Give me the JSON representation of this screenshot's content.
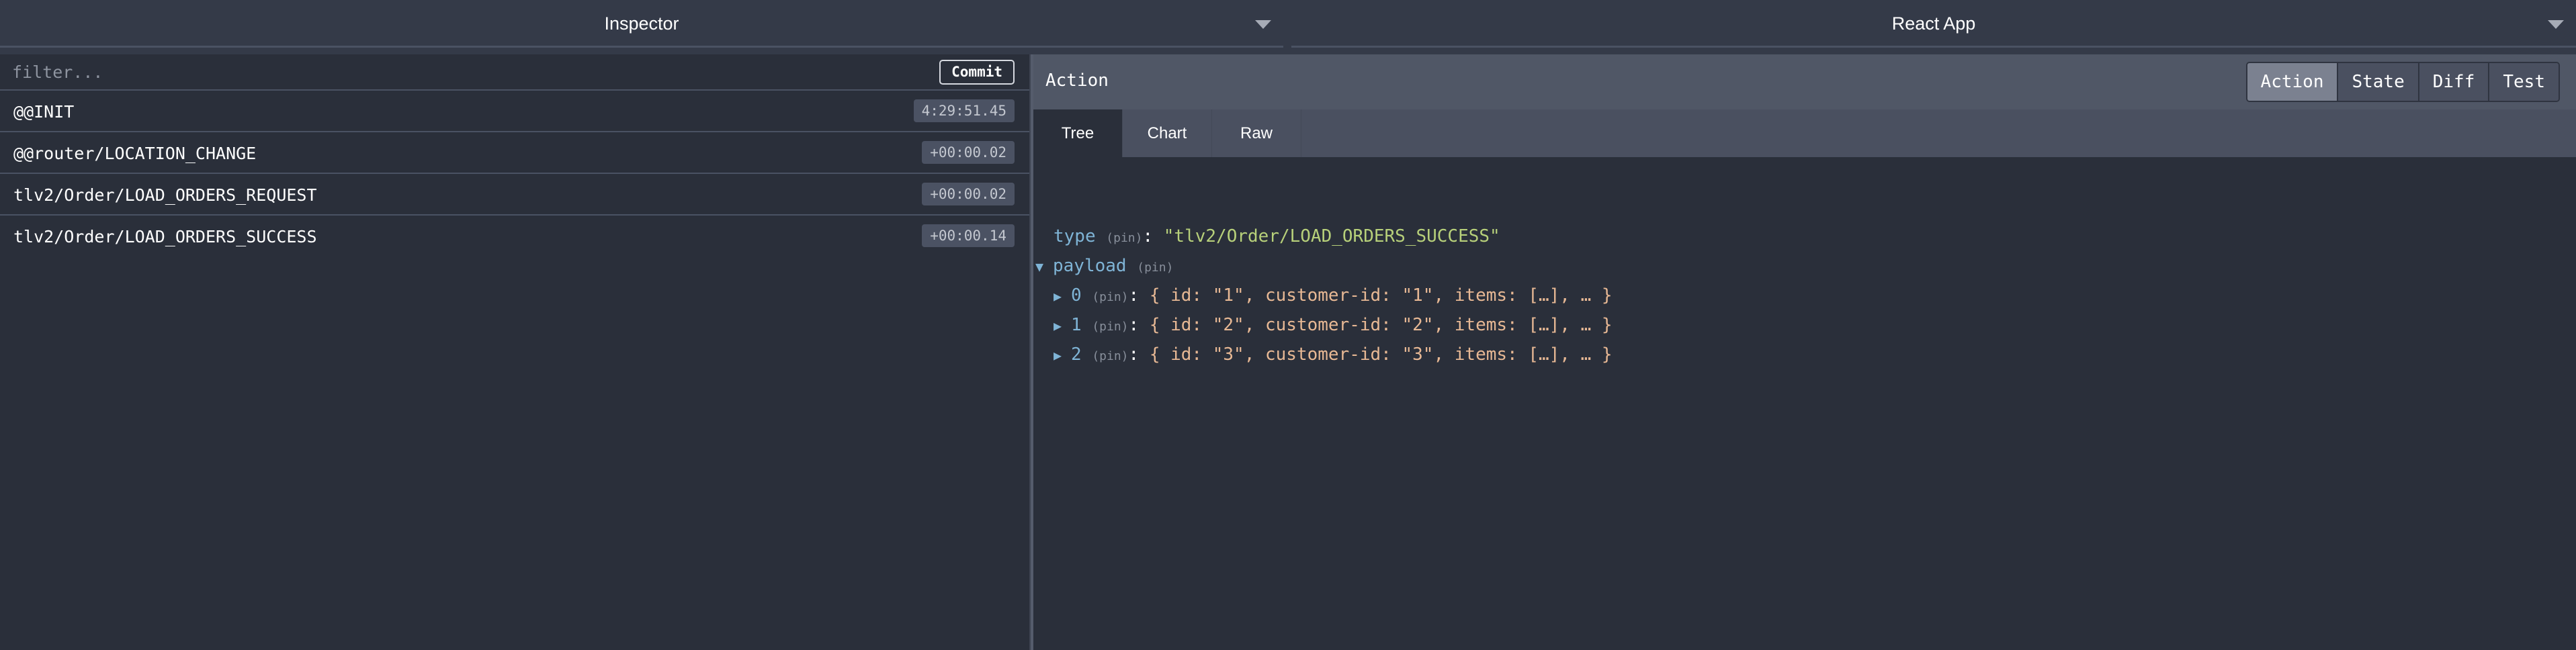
{
  "topbar": {
    "left_select": "Inspector",
    "right_select": "React App"
  },
  "filter": {
    "placeholder": "filter...",
    "value": ""
  },
  "commit_label": "Commit",
  "actions": [
    {
      "name": "@@INIT",
      "time": "4:29:51.45"
    },
    {
      "name": "@@router/LOCATION_CHANGE",
      "time": "+00:00.02"
    },
    {
      "name": "tlv2/Order/LOAD_ORDERS_REQUEST",
      "time": "+00:00.02"
    },
    {
      "name": "tlv2/Order/LOAD_ORDERS_SUCCESS",
      "time": "+00:00.14"
    }
  ],
  "inspector": {
    "title": "Action",
    "view_tabs": [
      "Action",
      "State",
      "Diff",
      "Test"
    ],
    "active_view_tab": "Action",
    "sub_tabs": [
      "Tree",
      "Chart",
      "Raw"
    ],
    "active_sub_tab": "Tree"
  },
  "tree": {
    "pin": "(pin)",
    "type_key": "type",
    "type_value": "\"tlv2/Order/LOAD_ORDERS_SUCCESS\"",
    "payload_key": "payload",
    "items": [
      {
        "key": "0",
        "value": "{ id: \"1\", customer-id: \"1\", items: […], … }"
      },
      {
        "key": "1",
        "value": "{ id: \"2\", customer-id: \"2\", items: […], … }"
      },
      {
        "key": "2",
        "value": "{ id: \"3\", customer-id: \"3\", items: […], … }"
      }
    ]
  },
  "colors": {
    "background": "#2a2f3a",
    "header": "#505766",
    "key": "#7fb4d6",
    "string": "#b7d07a",
    "value": "#e7b894"
  }
}
